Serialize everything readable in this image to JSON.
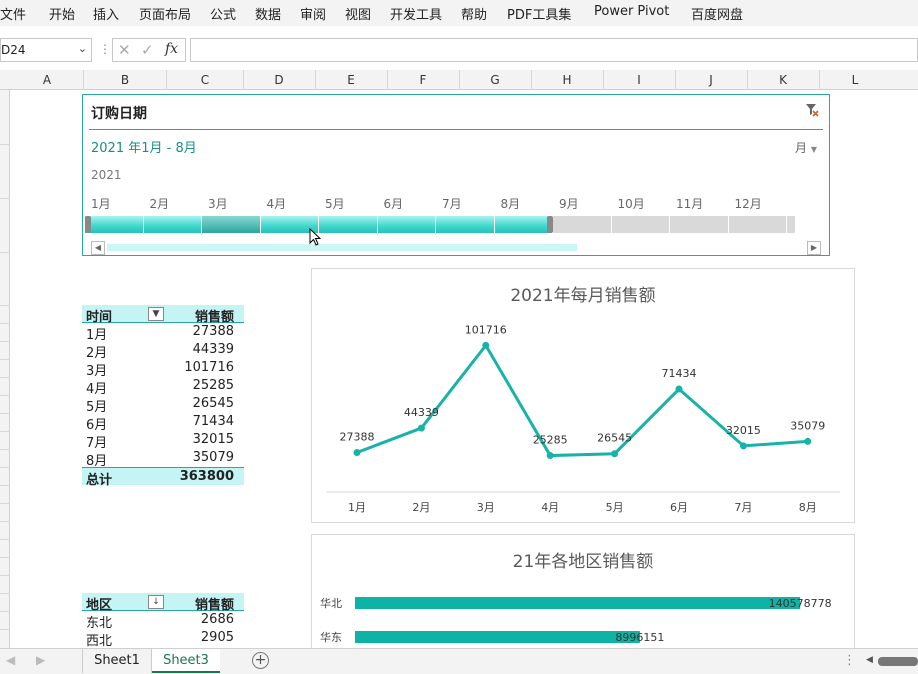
{
  "menu": [
    "文件",
    "开始",
    "插入",
    "页面布局",
    "公式",
    "数据",
    "审阅",
    "视图",
    "开发工具",
    "帮助",
    "PDF工具集",
    "Power Pivot",
    "百度网盘"
  ],
  "formula": {
    "namebox": "D24",
    "fx": "fx",
    "value": ""
  },
  "columns": [
    "A",
    "B",
    "C",
    "D",
    "E",
    "F",
    "G",
    "H",
    "I",
    "J",
    "K",
    "L"
  ],
  "slicer": {
    "title": "订购日期",
    "range": "2021 年1月 - 8月",
    "unit": "月",
    "year": "2021",
    "months": [
      "1月",
      "2月",
      "3月",
      "4月",
      "5月",
      "6月",
      "7月",
      "8月",
      "9月",
      "10月",
      "11月",
      "12月"
    ],
    "selected_from": 1,
    "selected_to": 8
  },
  "pivot1": {
    "header_left": "时间",
    "header_right": "销售额",
    "rows": [
      [
        "1月",
        "27388"
      ],
      [
        "2月",
        "44339"
      ],
      [
        "3月",
        "101716"
      ],
      [
        "4月",
        "25285"
      ],
      [
        "5月",
        "26545"
      ],
      [
        "6月",
        "71434"
      ],
      [
        "7月",
        "32015"
      ],
      [
        "8月",
        "35079"
      ]
    ],
    "total_label": "总计",
    "total_value": "363800"
  },
  "pivot2": {
    "header_left": "地区",
    "header_right": "销售额",
    "rows": [
      [
        "东北",
        "2686"
      ],
      [
        "西北",
        "2905"
      ]
    ]
  },
  "chart_data": [
    {
      "type": "line",
      "title": "2021年每月销售额",
      "categories": [
        "1月",
        "2月",
        "3月",
        "4月",
        "5月",
        "6月",
        "7月",
        "8月"
      ],
      "values": [
        27388,
        44339,
        101716,
        25285,
        26545,
        71434,
        32015,
        35079
      ],
      "color": "#17b3a8",
      "ylim": [
        0,
        120000
      ]
    },
    {
      "type": "bar",
      "title": "21年各地区销售额",
      "categories": [
        "华北",
        "华东"
      ],
      "values": [
        140578,
        89966
      ],
      "value_labels": [
        "140578778",
        "8996151"
      ],
      "color": "#0fb3a5",
      "xlim": [
        0,
        150000
      ]
    }
  ],
  "tabs": [
    "Sheet1",
    "Sheet3"
  ],
  "active_tab": "Sheet3"
}
